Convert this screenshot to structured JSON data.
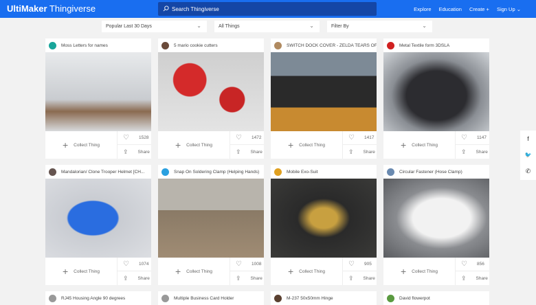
{
  "header": {
    "logo_bold": "UltiMaker",
    "logo_light": " Thingiverse",
    "search_placeholder": "Search Thingiverse",
    "nav": [
      "Explore",
      "Education",
      "Create +",
      "Sign Up ⌄"
    ]
  },
  "filters": [
    {
      "label": "Popular Last 30 Days"
    },
    {
      "label": "All Things"
    },
    {
      "label": "Filter By"
    }
  ],
  "card_actions": {
    "collect": "Collect Thing",
    "share": "Share"
  },
  "cards": [
    {
      "title": "Moss Letters for names",
      "likes": "1528",
      "avatar": "#18a59a",
      "img": "linear-gradient(180deg,#e8eaec,#c9ccd0 60%,#8a6a50 75%,#d8dadc)"
    },
    {
      "title": "5 mario cookie cutters",
      "likes": "1472",
      "avatar": "#6a4a3a",
      "img": "radial-gradient(circle at 30% 35%,#d42a2a 0 18%,transparent 19%),radial-gradient(circle at 70% 60%,#c82525 0 14%,transparent 15%),linear-gradient(#cfcfcf,#e4e4e4)"
    },
    {
      "title": "SWITCH DOCK COVER - ZELDA TEARS OF T...",
      "likes": "1417",
      "avatar": "#b08a60",
      "img": "linear-gradient(180deg,#7d8a96 0 30%,#2a2a2a 30% 70%,#c88a30 70%)"
    },
    {
      "title": "Metal Textile form 3DSLA",
      "likes": "1147",
      "avatar": "#d02020",
      "img": "radial-gradient(ellipse at 50% 55%,#2c2c30 0 40%,#8a8e94 60%,#d0d4d8)"
    },
    {
      "title": "Mandalorian/ Clone Trooper Helmet [CH...",
      "likes": "1074",
      "avatar": "#665550",
      "img": "radial-gradient(ellipse at 45% 50%,#2a6de0 0 30%,#c9ccd2 32%,#dcdee2)"
    },
    {
      "title": "Snap On Soldering Clamp (Helping Hands)",
      "likes": "1008",
      "avatar": "#2aa0e0",
      "img": "linear-gradient(180deg,#b8b4ac 0 40%,#8a7a66 40%,#a08c74)"
    },
    {
      "title": "Mobile Exo-Suit",
      "likes": "905",
      "avatar": "#e0a020",
      "img": "radial-gradient(ellipse at 50% 50%,#c8a040 0 18%,#2a2a2a 35%,#3a3a38)"
    },
    {
      "title": "Circular Fastener (Hose Clamp)",
      "likes": "856",
      "avatar": "#6a8ab0",
      "img": "radial-gradient(ellipse at 55% 50%,#f2f2f2 0 35%,#8a8c90 55%,#5a5c60)"
    },
    {
      "title": "RJ45 Housing Angle 90 degrees",
      "avatar": "#999"
    },
    {
      "title": "Multiple Business Card Holder",
      "avatar": "#999"
    },
    {
      "title": "M-237 50x50mm Hinge",
      "avatar": "#5a4030"
    },
    {
      "title": "David flowerpot",
      "avatar": "#5a9a40"
    }
  ],
  "social": [
    "f",
    "🐦",
    "✆"
  ]
}
